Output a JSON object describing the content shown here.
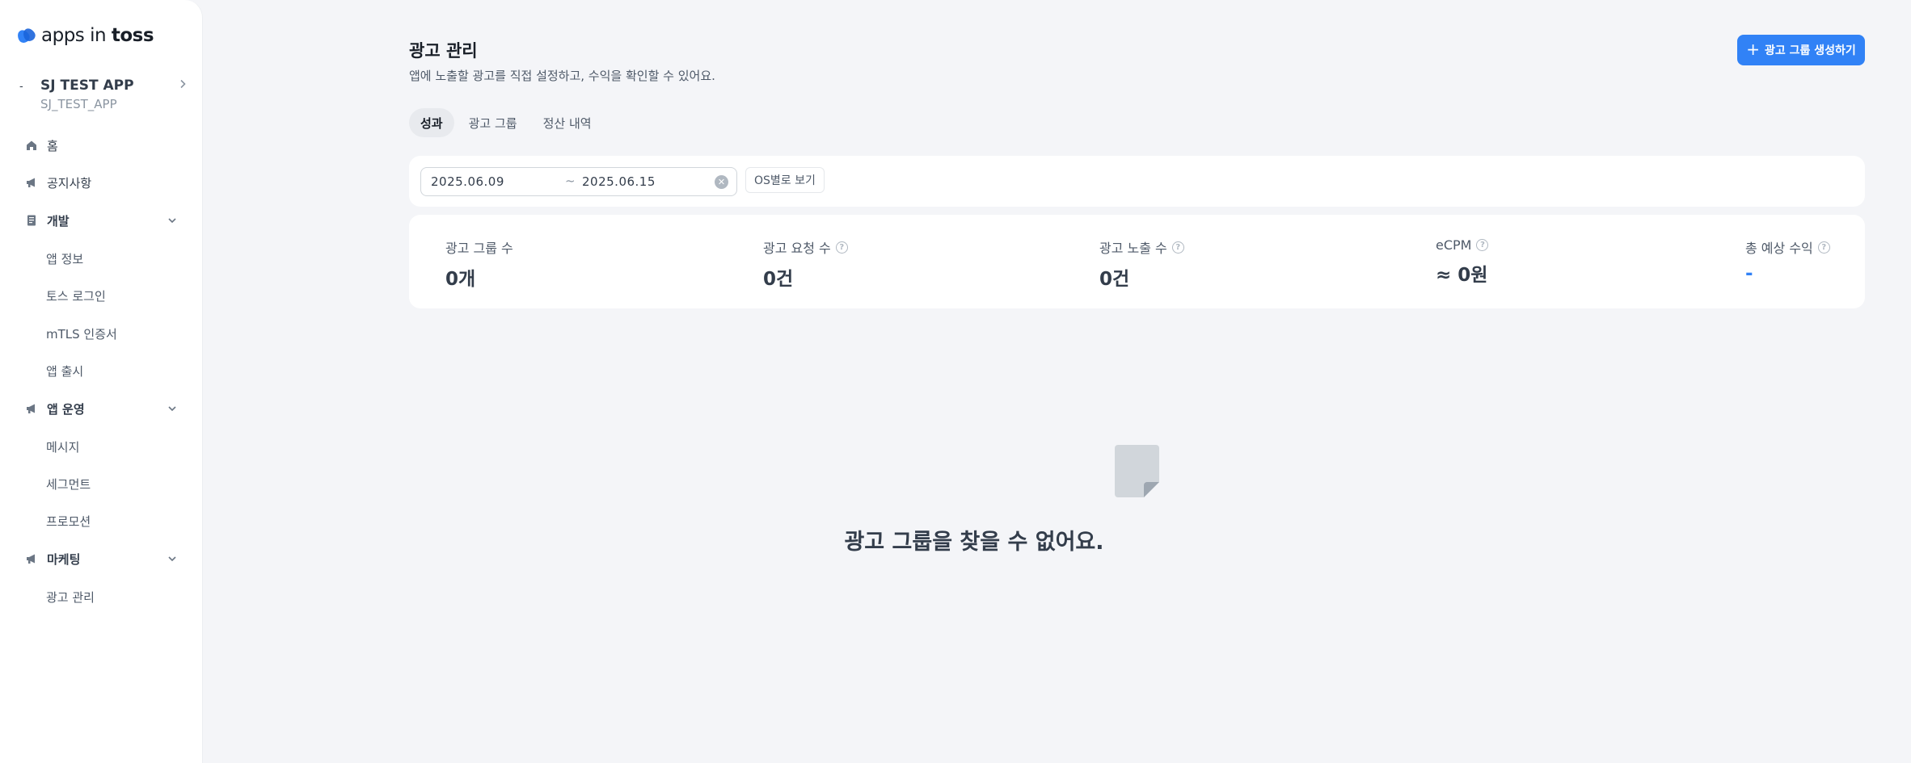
{
  "brand": {
    "logo_light": "apps in",
    "logo_bold": "toss"
  },
  "app": {
    "dash": "-",
    "name": "SJ TEST APP",
    "id": "SJ_TEST_APP"
  },
  "nav": {
    "home": "홈",
    "notice": "공지사항",
    "dev": "개발",
    "dev_items": [
      "앱 정보",
      "토스 로그인",
      "mTLS 인증서",
      "앱 출시"
    ],
    "ops": "앱 운영",
    "ops_items": [
      "메시지",
      "세그먼트",
      "프로모션"
    ],
    "marketing": "마케팅",
    "marketing_items": [
      "광고 관리"
    ]
  },
  "header": {
    "title": "광고 관리",
    "subtitle": "앱에 노출할 광고를 직접 설정하고, 수익을 확인할 수 있어요.",
    "create_label": "광고 그룹 생성하기"
  },
  "tabs": [
    "성과",
    "광고 그룹",
    "정산 내역"
  ],
  "filter": {
    "date_from": "2025.06.09",
    "tilde": "~",
    "date_to": "2025.06.15",
    "os_label": "OS별로 보기"
  },
  "stats": [
    {
      "label": "광고 그룹 수",
      "value": "0개",
      "help": false
    },
    {
      "label": "광고 요청 수",
      "value": "0건",
      "help": true
    },
    {
      "label": "광고 노출 수",
      "value": "0건",
      "help": true
    },
    {
      "label": "eCPM",
      "value": "≈ 0원",
      "help": true
    },
    {
      "label": "총 예상 수익",
      "value": "-",
      "help": true
    }
  ],
  "empty": {
    "message": "광고 그룹을 찾을 수 없어요."
  },
  "colors": {
    "accent": "#3182f6",
    "background": "#f4f5f8"
  }
}
